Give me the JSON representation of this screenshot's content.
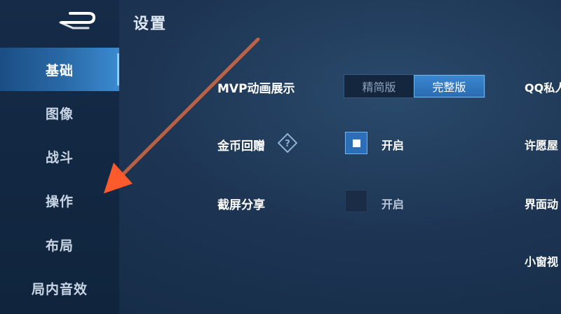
{
  "page": {
    "title": "设置"
  },
  "sidebar": {
    "items": [
      {
        "label": "基础",
        "active": true
      },
      {
        "label": "图像"
      },
      {
        "label": "战斗"
      },
      {
        "label": "操作"
      },
      {
        "label": "布局"
      },
      {
        "label": "局内音效"
      }
    ]
  },
  "settings": {
    "mvp": {
      "label": "MVP动画展示",
      "options": [
        "精简版",
        "完整版"
      ],
      "selected": "完整版"
    },
    "coin_gift": {
      "label": "金币回赠",
      "checkbox_label": "开启",
      "checked": true
    },
    "screenshot_share": {
      "label": "截屏分享",
      "checkbox_label": "开启",
      "checked": false
    }
  },
  "right_column": [
    "QQ私人",
    "许愿屋",
    "界面动",
    "小窗视"
  ],
  "colors": {
    "accent": "#2c6fb8",
    "arrow": "#ff5a2c"
  }
}
